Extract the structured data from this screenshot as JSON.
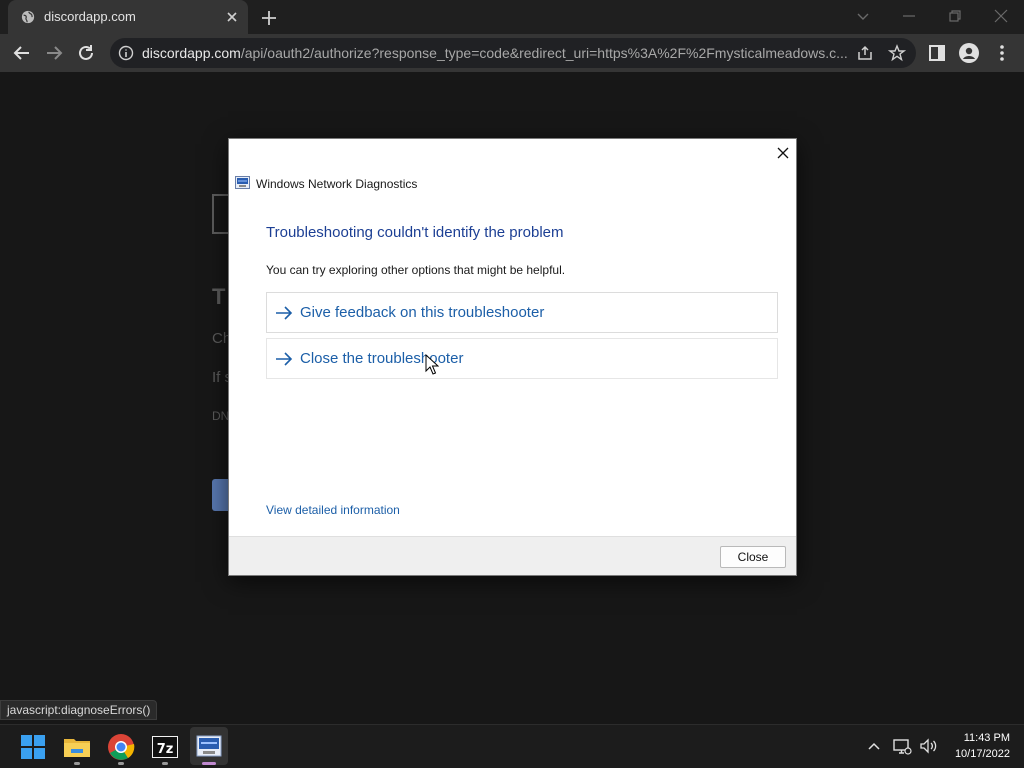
{
  "browser": {
    "tab_title": "discordapp.com",
    "url_host": "discordapp.com",
    "url_path": "/api/oauth2/authorize?response_type=code&redirect_uri=https%3A%2F%2Fmysticalmeadows.c..."
  },
  "background_page": {
    "heading_fragment": "T",
    "line1_fragment": "Ch",
    "line2_fragment": "If s",
    "code_fragment": "DN"
  },
  "dialog": {
    "app_title": "Windows Network Diagnostics",
    "heading": "Troubleshooting couldn't identify the problem",
    "subtext": "You can try exploring other options that might be helpful.",
    "options": [
      {
        "label": "Give feedback on this troubleshooter"
      },
      {
        "label": "Close the troubleshooter"
      }
    ],
    "details_link": "View detailed information",
    "close_button": "Close"
  },
  "status_bar": "javascript:diagnoseErrors()",
  "taskbar": {
    "apps": [
      "start-icon",
      "file-explorer-icon",
      "chrome-icon",
      "7zip-icon",
      "network-diagnostics-icon"
    ],
    "time": "11:43 PM",
    "date": "10/17/2022"
  },
  "colors": {
    "dialog_heading": "#1c3f94",
    "link": "#1c5fa8",
    "page_bg": "#171717",
    "toolbar_bg": "#353535"
  }
}
